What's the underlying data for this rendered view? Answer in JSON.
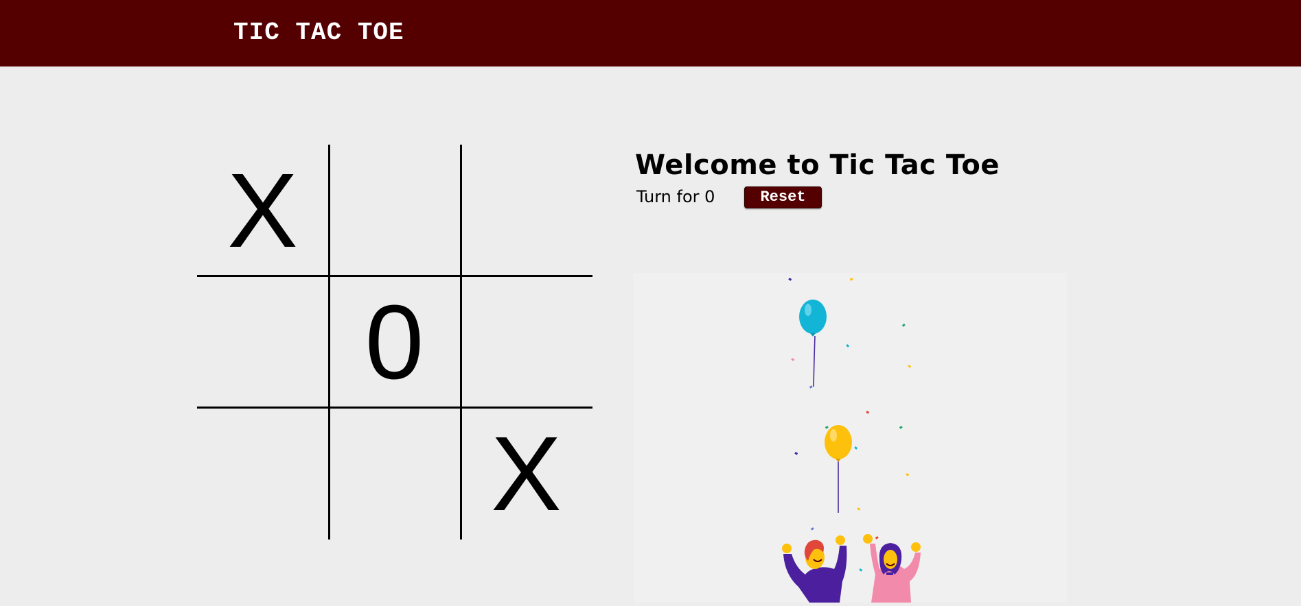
{
  "navbar": {
    "title": "TIC TAC TOE"
  },
  "board": {
    "cells": [
      "X",
      "",
      "",
      "",
      "0",
      "",
      "",
      "",
      "X"
    ]
  },
  "info": {
    "heading": "Welcome to Tic Tac Toe",
    "turn_text": "Turn for 0",
    "reset_label": "Reset"
  },
  "colors": {
    "navbar_bg": "#540000",
    "page_bg": "#ededed",
    "balloon_blue": "#12b5d6",
    "balloon_yellow": "#fdc10d",
    "shirt_purple": "#4b1f9e",
    "shirt_pink": "#f28bab"
  },
  "illustration": {
    "icon": "celebration-balloons-illustration"
  }
}
